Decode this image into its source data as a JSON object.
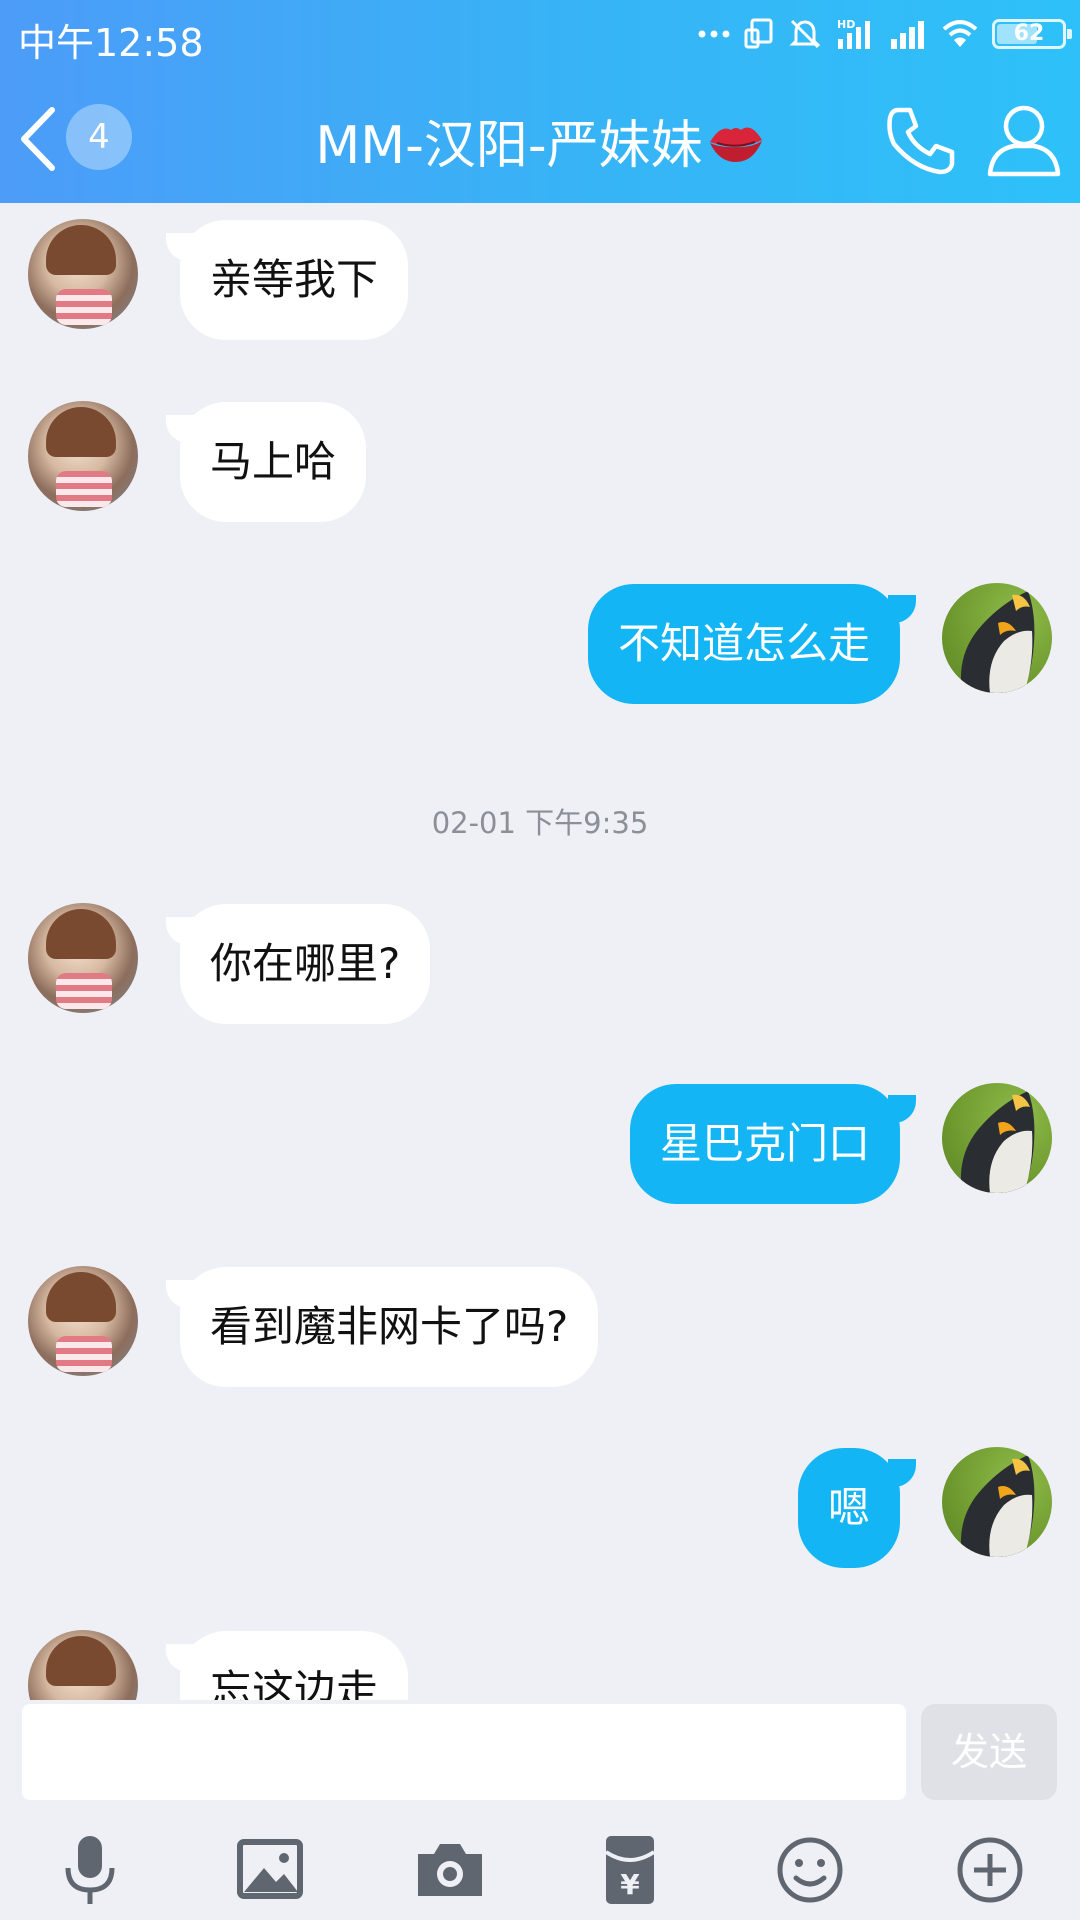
{
  "status_bar": {
    "time": "中午12:58",
    "battery": "62",
    "battery_level": 0.62
  },
  "header": {
    "back_icon": "chevron-left-icon",
    "unread_count": "4",
    "title": "MM-汉阳-严妹妹",
    "title_emoji": "lips-icon",
    "call_icon": "phone-icon",
    "profile_icon": "person-icon",
    "color_start": "#4c9cf8",
    "color_end": "#2ec1f9"
  },
  "chat": {
    "messages": [
      {
        "from": "other",
        "text": "亲等我下"
      },
      {
        "from": "other",
        "text": "马上哈"
      },
      {
        "from": "me",
        "text": "不知道怎么走"
      },
      {
        "type": "timestamp",
        "text": "02-01 下午9:35"
      },
      {
        "from": "other",
        "text": "你在哪里?"
      },
      {
        "from": "me",
        "text": "星巴克门口"
      },
      {
        "from": "other",
        "text": "看到魔非网卡了吗?"
      },
      {
        "from": "me",
        "text": "嗯"
      },
      {
        "from": "other",
        "text": "忘这边走"
      }
    ],
    "incoming_bubble_color": "#ffffff",
    "outgoing_bubble_color": "#13b5f5"
  },
  "input": {
    "value": "",
    "placeholder": "",
    "send_label": "发送"
  },
  "toolbar": {
    "items": [
      "microphone-icon",
      "image-icon",
      "camera-icon",
      "red-packet-icon",
      "emoji-icon",
      "plus-icon"
    ]
  }
}
